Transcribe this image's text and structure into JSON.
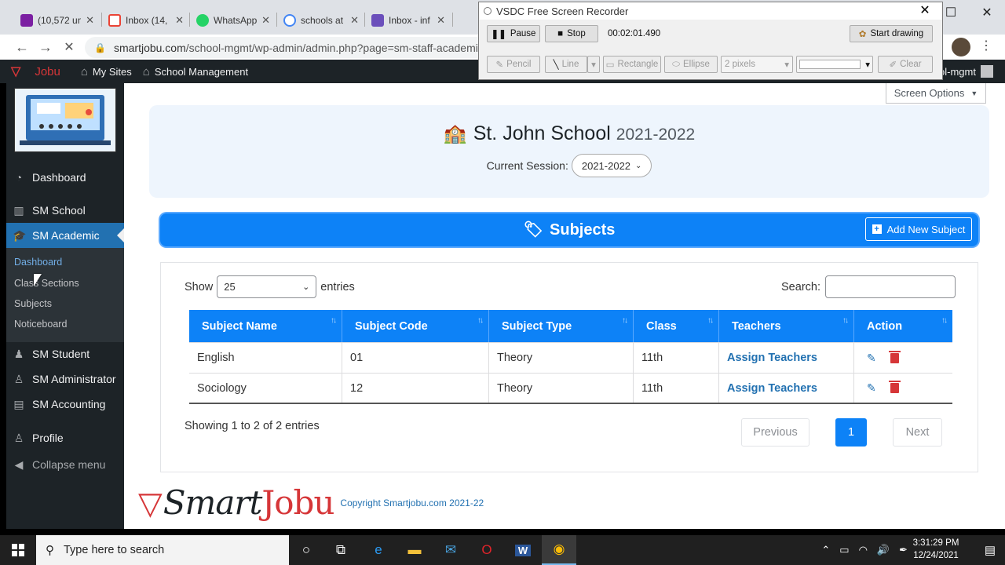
{
  "browser": {
    "tabs": [
      {
        "label": "(10,572 un",
        "icon": "mail-icon",
        "color": "#7b1fa2"
      },
      {
        "label": "Inbox (14,",
        "icon": "gmail-icon",
        "color": "#ea4335"
      },
      {
        "label": "WhatsApp",
        "icon": "whatsapp-icon",
        "color": "#25d366"
      },
      {
        "label": "schools at",
        "icon": "google-icon",
        "color": "#4285f4"
      },
      {
        "label": "Inbox - inf",
        "icon": "inbox-icon",
        "color": "#6b4fbb"
      }
    ],
    "tab_close": "✕",
    "url_host": "smartjobu.com",
    "url_path": "/school-mgmt/wp-admin/admin.php?page=sm-staff-academic"
  },
  "wpbar": {
    "site_brand": "Jobu",
    "my_sites": "My Sites",
    "school_mgmt": "School Management",
    "user": "ol-mgmt"
  },
  "sidebar": {
    "items": [
      {
        "label": "Dashboard",
        "icon": "dashboard-icon"
      },
      {
        "label": "SM School",
        "icon": "building-icon"
      },
      {
        "label": "SM Academic",
        "icon": "graduation-cap-icon"
      },
      {
        "label": "SM Student",
        "icon": "students-icon"
      },
      {
        "label": "SM Administrator",
        "icon": "admin-user-icon"
      },
      {
        "label": "SM Accounting",
        "icon": "accounting-icon"
      },
      {
        "label": "Profile",
        "icon": "profile-icon"
      },
      {
        "label": "Collapse menu",
        "icon": "collapse-icon"
      }
    ],
    "submenu": [
      "Dashboard",
      "Class Sections",
      "Subjects",
      "Noticeboard"
    ]
  },
  "content": {
    "screen_options": "Screen Options",
    "school_name": "St. John School",
    "school_year": "2021-2022",
    "session_label": "Current Session:",
    "session_value": "2021-2022",
    "section_title": "Subjects",
    "add_button": "Add New Subject",
    "show_label": "Show",
    "entries_label": "entries",
    "page_length": "25",
    "search_label": "Search:",
    "table": {
      "columns": [
        "Subject Name",
        "Subject Code",
        "Subject Type",
        "Class",
        "Teachers",
        "Action"
      ],
      "rows": [
        {
          "name": "English",
          "code": "01",
          "type": "Theory",
          "class": "11th",
          "teachers": "Assign Teachers"
        },
        {
          "name": "Sociology",
          "code": "12",
          "type": "Theory",
          "class": "11th",
          "teachers": "Assign Teachers"
        }
      ]
    },
    "info": "Showing 1 to 2 of 2 entries",
    "pager": {
      "previous": "Previous",
      "current": "1",
      "next": "Next"
    },
    "footer_logo_a": "Smart",
    "footer_logo_b": "Jobu",
    "copyright": "Copyright Smartjobu.com 2021-22"
  },
  "vsdc": {
    "title": "VSDC Free Screen Recorder",
    "pause": "Pause",
    "stop": "Stop",
    "time": "00:02:01.490",
    "start_drawing": "Start drawing",
    "pencil": "Pencil",
    "line": "Line",
    "rectangle": "Rectangle",
    "ellipse": "Ellipse",
    "pixels": "2 pixels",
    "clear": "Clear"
  },
  "taskbar": {
    "search_placeholder": "Type here to search",
    "time": "3:31:29 PM",
    "date": "12/24/2021"
  }
}
